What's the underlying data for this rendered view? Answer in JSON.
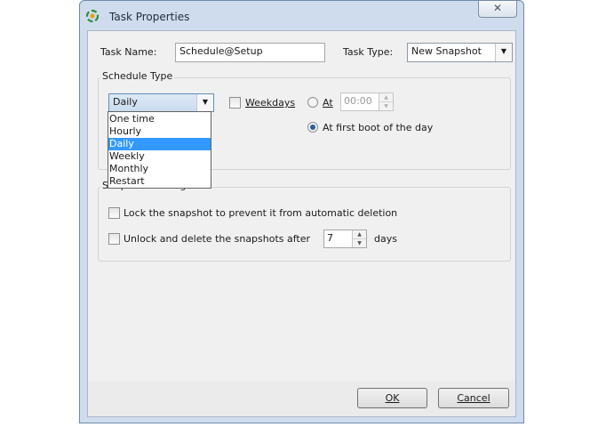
{
  "window": {
    "title": "Task Properties",
    "close_glyph": "✕"
  },
  "task": {
    "name_label": "Task Name:",
    "name_value": "Schedule@Setup",
    "type_label": "Task Type:",
    "type_value": "New Snapshot"
  },
  "schedule": {
    "group_label": "Schedule Type",
    "selected": "Daily",
    "options": [
      "One time",
      "Hourly",
      "Daily",
      "Weekly",
      "Monthly",
      "Restart"
    ],
    "weekdays_label": "Weekdays",
    "weekdays_checked": false,
    "at_label": "At",
    "at_time": "00:00",
    "first_boot_label": "At first boot of the day",
    "first_boot_selected": true
  },
  "snapshot_settings": {
    "group_label": "Snapshot Settings",
    "lock_label": "Lock the snapshot to prevent it from automatic deletion",
    "lock_checked": false,
    "unlock_label": "Unlock and delete the snapshots after",
    "unlock_checked": false,
    "days_value": "7",
    "days_label": "days"
  },
  "buttons": {
    "ok": "OK",
    "cancel": "Cancel"
  },
  "icons": {
    "app": "snapshot-app-icon",
    "dropdown": "chevron-down-icon",
    "spin_up": "spin-up-icon",
    "spin_down": "spin-down-icon"
  },
  "colors": {
    "selection": "#3399ff",
    "window_frame": "#cfdced",
    "client_bg": "#f0f0f0"
  }
}
